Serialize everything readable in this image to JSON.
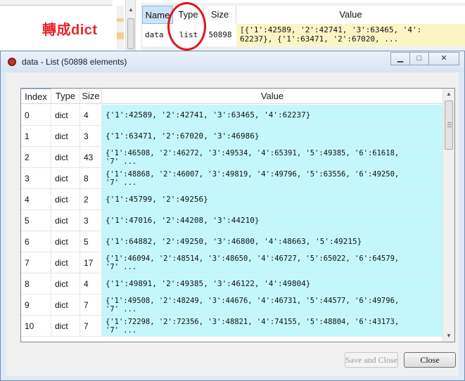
{
  "background": {
    "annotation_text": "轉成dict",
    "var_explorer": {
      "headers": {
        "name": "Name",
        "type": "Type",
        "size": "Size",
        "value": "Value"
      },
      "row": {
        "name": "data",
        "type": "list",
        "size": "50898",
        "value": "[{'1':42589, '2':42741, '3':63465, '4':\n62237}, {'1':63471, '2':67020, ..."
      }
    }
  },
  "dialog": {
    "title": "data - List (50898 elements)",
    "window_controls": {
      "minimize": "▁",
      "maximize": "□",
      "close": "✕"
    },
    "table": {
      "headers": {
        "index": "Index",
        "type": "Type",
        "size": "Size",
        "value": "Value"
      },
      "rows": [
        {
          "index": "0",
          "type": "dict",
          "size": "4",
          "value": "{'1':42589, '2':42741, '3':63465, '4':62237}"
        },
        {
          "index": "1",
          "type": "dict",
          "size": "3",
          "value": "{'1':63471, '2':67020, '3':46986}"
        },
        {
          "index": "2",
          "type": "dict",
          "size": "43",
          "value": "{'1':46508, '2':46272, '3':49534, '4':65391, '5':49385, '6':61618,\n'7' ..."
        },
        {
          "index": "3",
          "type": "dict",
          "size": "8",
          "value": "{'1':48868, '2':46007, '3':49819, '4':49796, '5':63556, '6':49250,\n'7' ..."
        },
        {
          "index": "4",
          "type": "dict",
          "size": "2",
          "value": "{'1':45799, '2':49256}"
        },
        {
          "index": "5",
          "type": "dict",
          "size": "3",
          "value": "{'1':47016, '2':44208, '3':44210}"
        },
        {
          "index": "6",
          "type": "dict",
          "size": "5",
          "value": "{'1':64882, '2':49250, '3':46800, '4':48663, '5':49215}"
        },
        {
          "index": "7",
          "type": "dict",
          "size": "17",
          "value": "{'1':46094, '2':48514, '3':48650, '4':46727, '5':65022, '6':64579,\n'7' ..."
        },
        {
          "index": "8",
          "type": "dict",
          "size": "4",
          "value": "{'1':49891, '2':49385, '3':46122, '4':49804}"
        },
        {
          "index": "9",
          "type": "dict",
          "size": "7",
          "value": "{'1':49508, '2':48249, '3':44676, '4':46731, '5':44577, '6':49796,\n'7' ..."
        },
        {
          "index": "10",
          "type": "dict",
          "size": "7",
          "value": "{'1':72298, '2':72356, '3':48821, '4':74155, '5':48804, '6':43173,\n'7' ..."
        }
      ]
    },
    "buttons": {
      "save_and_close": "Save and Close",
      "close": "Close"
    }
  },
  "colors": {
    "value_cell": "#c4f7fb",
    "annotation": "#e8262b",
    "highlight_circle": "#e2141c"
  }
}
